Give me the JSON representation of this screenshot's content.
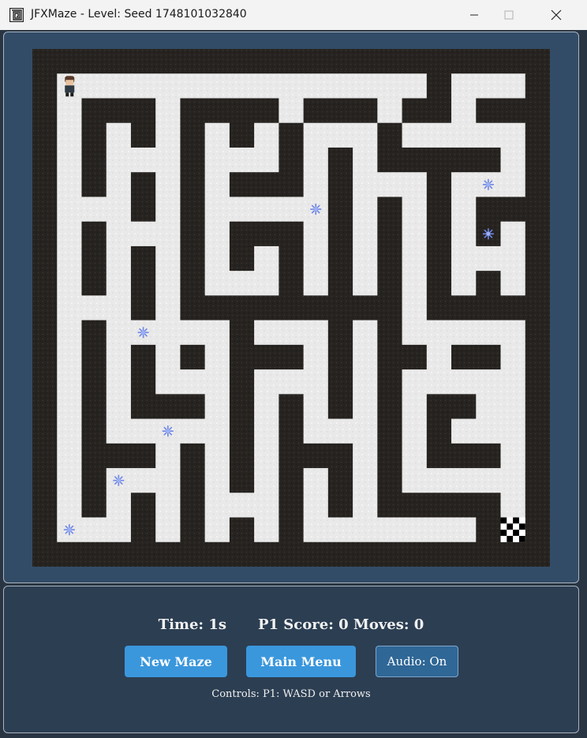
{
  "window": {
    "title": "JFXMaze - Level: Seed 1748101032840",
    "icon": "maze-app-icon"
  },
  "maze": {
    "cols": 21,
    "rows": 21,
    "rows_layout": [
      "#####################",
      "#S..............#...#",
      "#.###.####.###.##.###",
      "#.#.#.#.#.#...#.....#",
      "#.#...#...#.#.#####.#",
      "#.#.#.#.###.#...#...#",
      "#...#.#.....#.#.#.###",
      "#.#...#.###.#.#.#.#.#",
      "#.#.#.#.#.#.#.#.#...#",
      "#.#.#.#...#.#.#.#.#.#",
      "#...#.#########.#####",
      "#.#.....#...#.#.....#",
      "#.#.#.#.###.#.##.##.#",
      "#.#.#...#...#.#.....#",
      "#.#.###.#.#.#.#.##..#",
      "#.#.....#.#...#.#...#",
      "#.###.#.#.###.#.###.#",
      "#.#...#.#.#.#.#.....#",
      "#.#.#.#...#.#.#####.#",
      "#...#.#.#.#.......#G#",
      "#####################"
    ],
    "player": {
      "row": 1,
      "col": 1,
      "label": "player-sprite"
    },
    "goal": {
      "row": 19,
      "col": 19,
      "label": "finish-flag"
    },
    "collectibles": [
      {
        "row": 5,
        "col": 18
      },
      {
        "row": 6,
        "col": 11
      },
      {
        "row": 7,
        "col": 18
      },
      {
        "row": 11,
        "col": 4
      },
      {
        "row": 15,
        "col": 5
      },
      {
        "row": 17,
        "col": 3
      },
      {
        "row": 19,
        "col": 1
      }
    ],
    "colors": {
      "wall": "#262320",
      "floor": "#e8e8e8",
      "gem": "#6f86e6"
    }
  },
  "status": {
    "time": "Time: 1s",
    "score": "P1 Score: 0 Moves: 0"
  },
  "buttons": {
    "new_maze": "New Maze",
    "main_menu": "Main Menu",
    "audio": "Audio: On"
  },
  "controls_hint": "Controls: P1: WASD or Arrows",
  "colors": {
    "accent": "#3a97dc",
    "panel": "#324c67"
  }
}
